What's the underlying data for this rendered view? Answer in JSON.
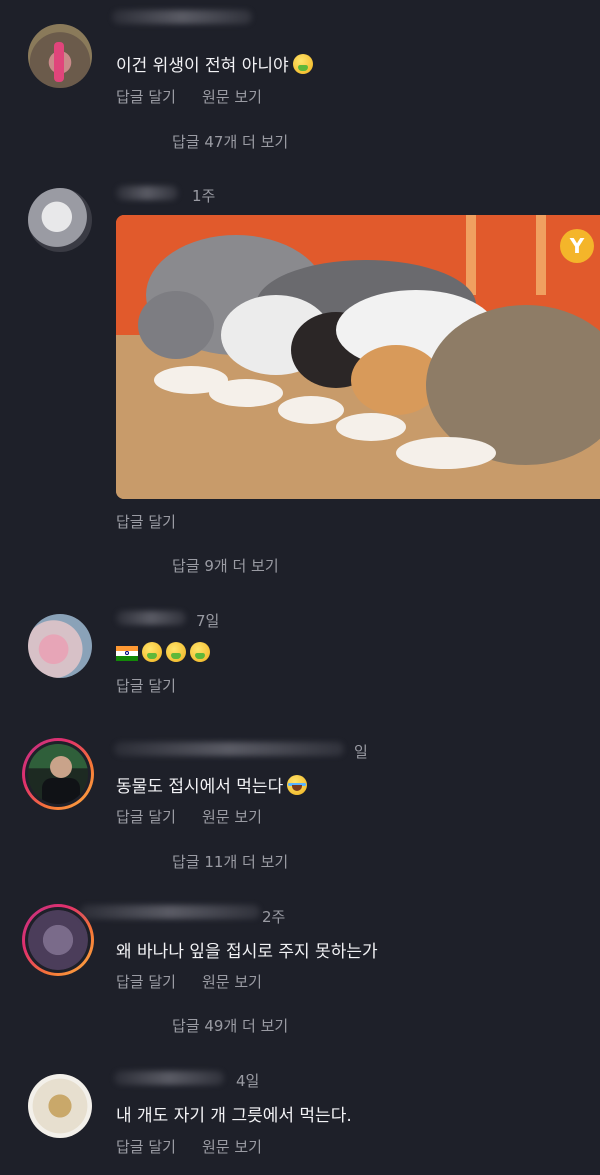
{
  "comments": [
    {
      "text": "이건 위생이 전혀 아니야",
      "time": "",
      "actions": [
        "답글 달기",
        "원문 보기"
      ],
      "more_replies": "답글 47개 더 보기"
    },
    {
      "text": "",
      "time": "1주",
      "actions": [
        "답글 달기"
      ],
      "more_replies": "답글 9개 더 보기"
    },
    {
      "text": "",
      "time": "7일",
      "actions": [
        "답글 달기"
      ],
      "more_replies": ""
    },
    {
      "text": "동물도 접시에서 먹는다",
      "time": "일",
      "actions": [
        "답글 달기",
        "원문 보기"
      ],
      "more_replies": "답글 11개 더 보기"
    },
    {
      "text": "왜 바나나 잎을 접시로 주지 못하는가",
      "time": "2주",
      "actions": [
        "답글 달기",
        "원문 보기"
      ],
      "more_replies": "답글 49개 더 보기"
    },
    {
      "text": "내 개도 자기 개 그릇에서 먹는다.",
      "time": "4일",
      "actions": [
        "답글 달기",
        "원문 보기"
      ],
      "more_replies": ""
    }
  ],
  "icons": {
    "emoji_nauseated": "nauseated-face-icon",
    "emoji_laugh": "tears-of-joy-icon",
    "flag": "india-flag-icon",
    "badge": "fork-icon"
  },
  "colors": {
    "background": "#1e2029",
    "text": "#f2f2f5",
    "meta": "#9a9ba3",
    "badge": "#f4b52a"
  }
}
